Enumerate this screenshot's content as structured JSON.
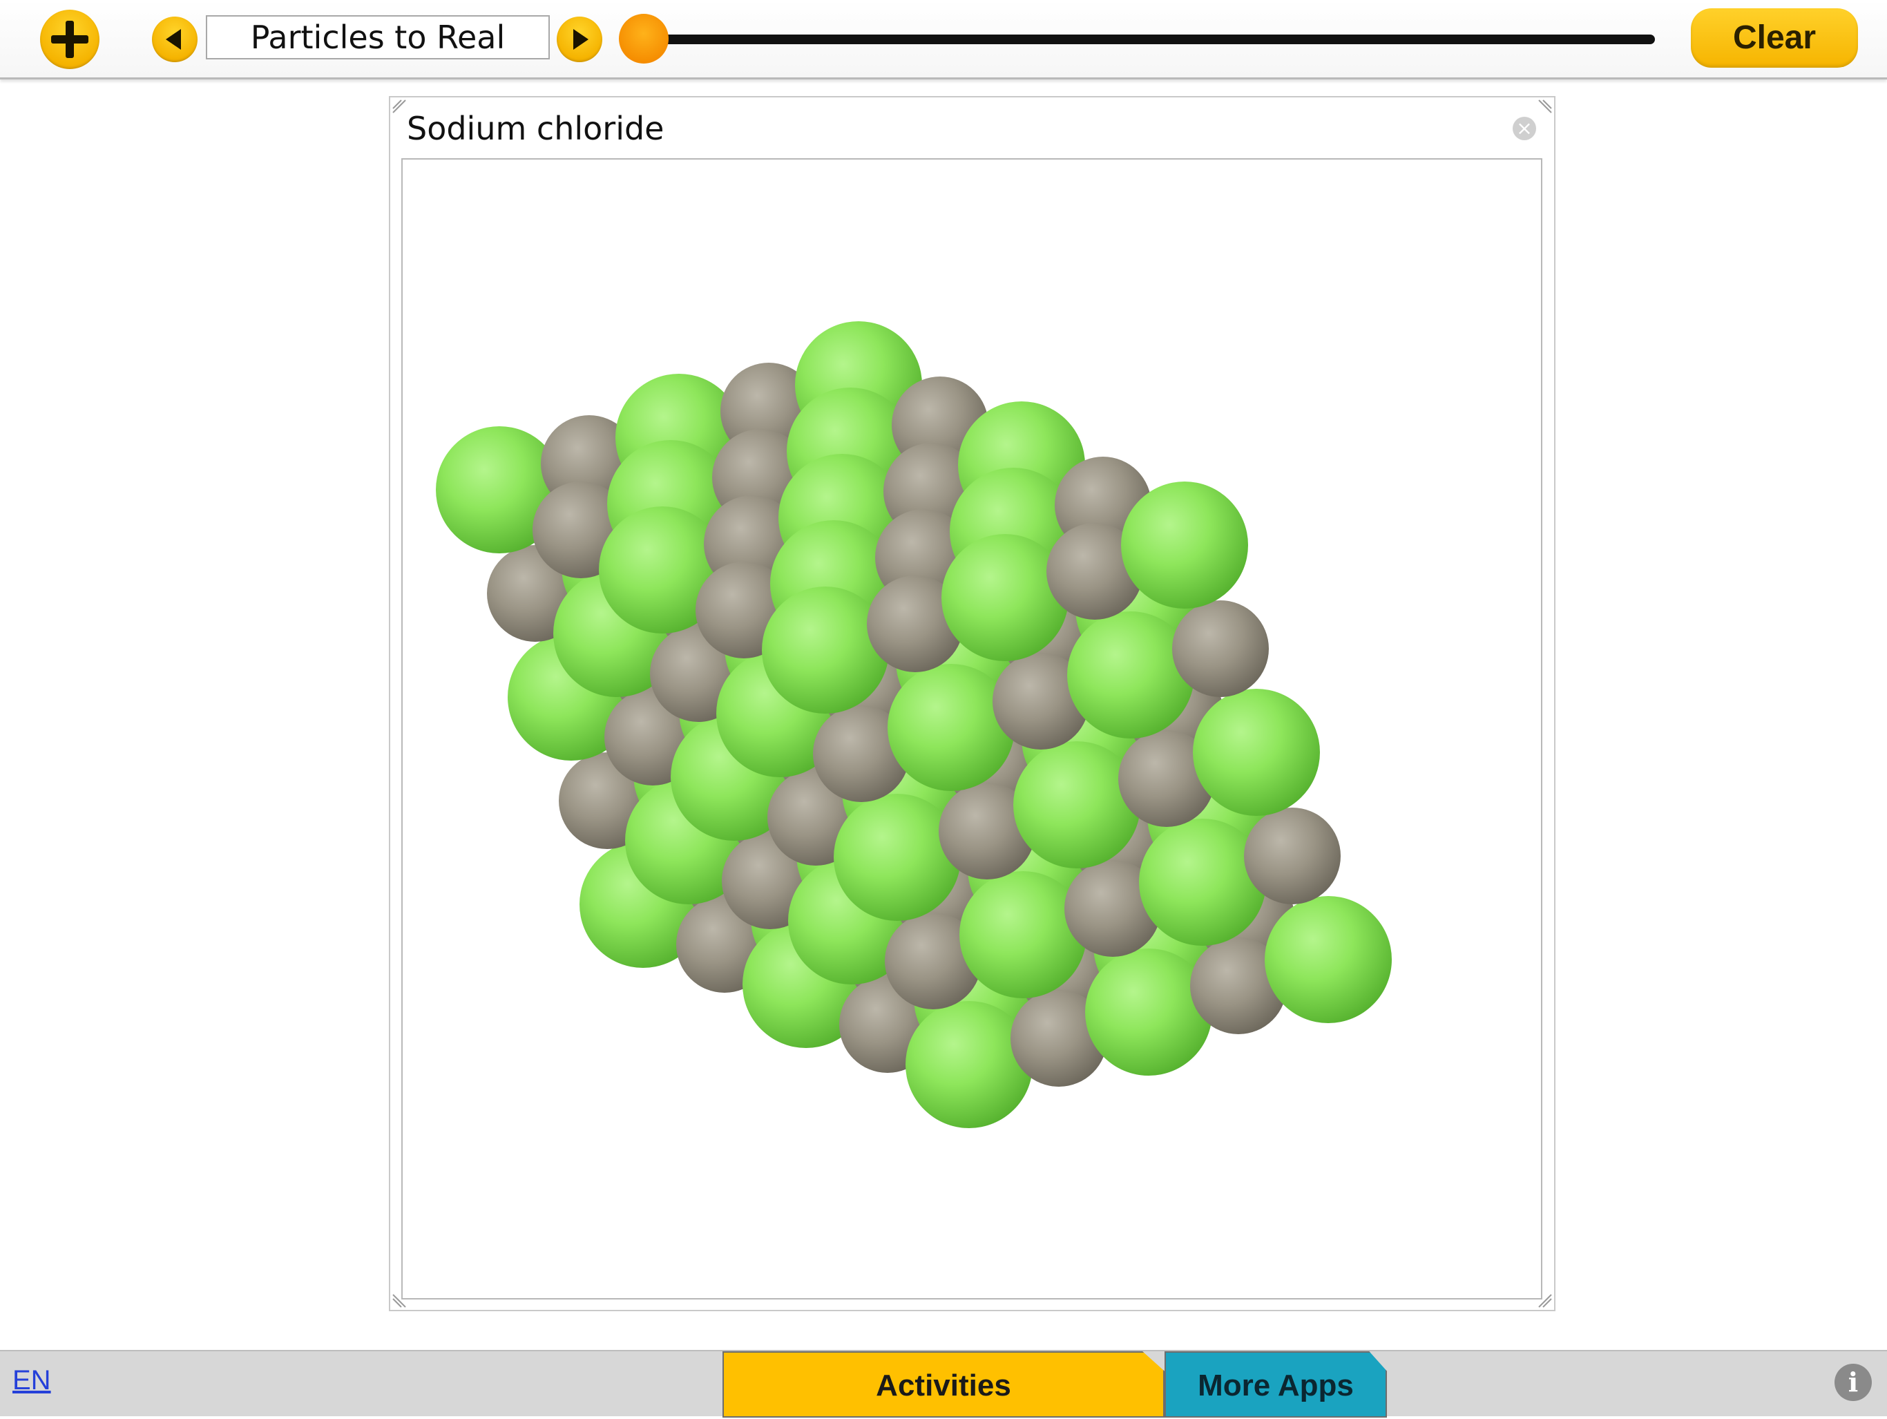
{
  "toolbar": {
    "add_icon": "plus-icon",
    "prev_icon": "triangle-left-icon",
    "next_icon": "triangle-right-icon",
    "title": "Particles to Real",
    "slider_value": 0,
    "clear_label": "Clear"
  },
  "viewer": {
    "title": "Sodium chloride",
    "close_icon": "close-circle-icon",
    "model": {
      "grid_size": 5,
      "chloride_color": "#8ee65b",
      "sodium_color": "#9a9485"
    }
  },
  "footer": {
    "language": "EN",
    "tabs": [
      {
        "label": "Activities",
        "color": "#ffc000"
      },
      {
        "label": "More Apps",
        "color": "#1aa3c0"
      }
    ],
    "info_icon": "info-icon"
  },
  "colors": {
    "accent": "#f6b400",
    "slider_knob": "#f58c00"
  }
}
